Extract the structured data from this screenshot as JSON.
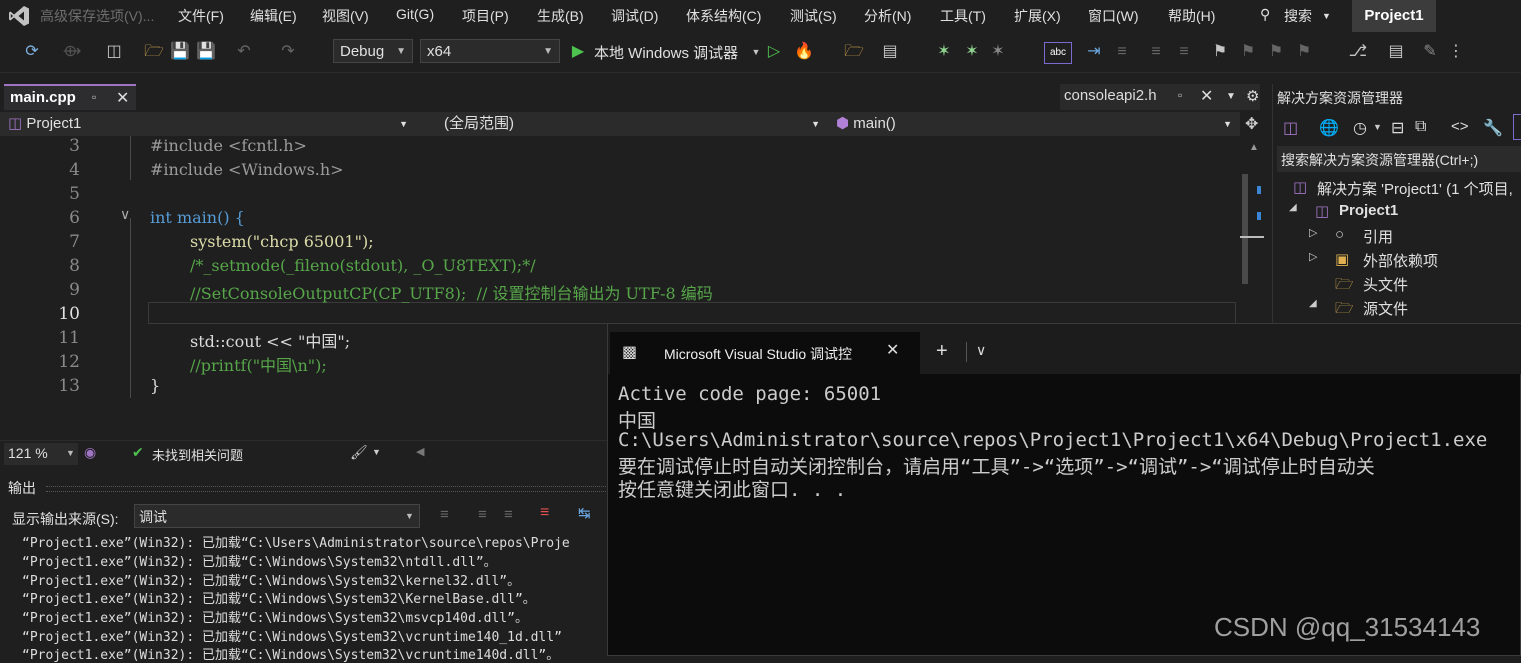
{
  "app": {
    "window_search_title": "高级保存选项(V)...",
    "menus": [
      "文件(F)",
      "编辑(E)",
      "视图(V)",
      "Git(G)",
      "项目(P)",
      "生成(B)",
      "调试(D)",
      "体系结构(C)",
      "测试(S)",
      "分析(N)",
      "工具(T)",
      "扩展(X)",
      "窗口(W)",
      "帮助(H)"
    ],
    "search_label": "搜索",
    "project_badge": "Project1"
  },
  "toolbar": {
    "config": "Debug",
    "platform": "x64",
    "run_label": "本地 Windows 调试器"
  },
  "editor": {
    "tab_active": "main.cpp",
    "tab_other": "consoleapi2.h",
    "nav_project": "Project1",
    "nav_scope": "(全局范围)",
    "nav_member": "main()",
    "zoom": "121 %",
    "issues": "未找到相关问题",
    "lines": [
      {
        "n": "3",
        "text": "#include <fcntl.h>"
      },
      {
        "n": "4",
        "text": "#include <Windows.h>"
      },
      {
        "n": "5",
        "text": ""
      },
      {
        "n": "6",
        "text": "int main() {"
      },
      {
        "n": "7",
        "text": "system(\"chcp 65001\");"
      },
      {
        "n": "8",
        "text": "/*_setmode(_fileno(stdout), _O_U8TEXT);*/"
      },
      {
        "n": "9",
        "text": "//SetConsoleOutputCP(CP_UTF8);  // 设置控制台输出为 UTF-8 编码"
      },
      {
        "n": "10",
        "text": ""
      },
      {
        "n": "11",
        "text": "std::cout << \"中国\";"
      },
      {
        "n": "12",
        "text": "//printf(\"中国\\n\");"
      },
      {
        "n": "13",
        "text": "}"
      }
    ]
  },
  "output": {
    "title": "输出",
    "source_label": "显示输出来源(S):",
    "source_value": "调试",
    "lines": [
      "“Project1.exe”(Win32): 已加载“C:\\Users\\Administrator\\source\\repos\\Proje",
      "“Project1.exe”(Win32): 已加载“C:\\Windows\\System32\\ntdll.dll”。",
      "“Project1.exe”(Win32): 已加载“C:\\Windows\\System32\\kernel32.dll”。",
      "“Project1.exe”(Win32): 已加载“C:\\Windows\\System32\\KernelBase.dll”。",
      "“Project1.exe”(Win32): 已加载“C:\\Windows\\System32\\msvcp140d.dll”。",
      "“Project1.exe”(Win32): 已加载“C:\\Windows\\System32\\vcruntime140_1d.dll”",
      "“Project1.exe”(Win32): 已加载“C:\\Windows\\System32\\vcruntime140d.dll”。"
    ]
  },
  "solution_explorer": {
    "title": "解决方案资源管理器",
    "search_placeholder": "搜索解决方案资源管理器(Ctrl+;)",
    "solution": "解决方案 'Project1' (1 个项目,",
    "project": "Project1",
    "items": [
      "引用",
      "外部依赖项",
      "头文件",
      "源文件"
    ]
  },
  "console": {
    "tab_title": "Microsoft Visual Studio 调试控",
    "lines": [
      "Active code page: 65001",
      "中国",
      "C:\\Users\\Administrator\\source\\repos\\Project1\\Project1\\x64\\Debug\\Project1.exe",
      "要在调试停止时自动关闭控制台，请启用“工具”->“选项”->“调试”->“调试停止时自动关",
      "按任意键关闭此窗口. . ."
    ]
  },
  "watermark": "CSDN @qq_31534143"
}
